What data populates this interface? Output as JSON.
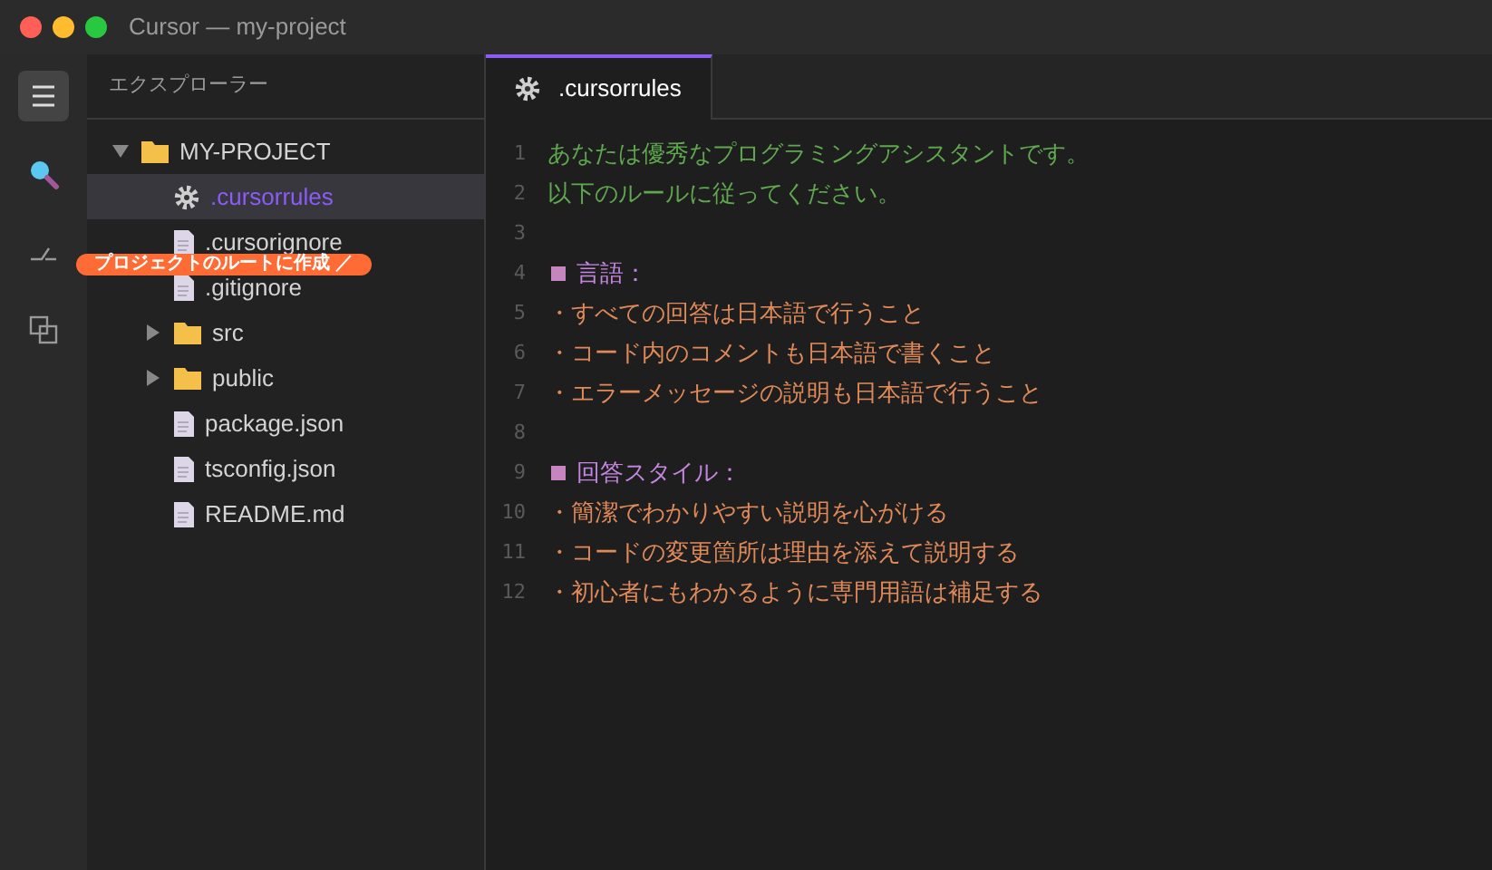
{
  "window": {
    "title": "Cursor — my-project"
  },
  "activity_bar": [
    {
      "kind": "menu",
      "selected": true
    },
    {
      "kind": "search",
      "selected": false
    },
    {
      "kind": "git",
      "selected": false
    },
    {
      "kind": "extensions",
      "selected": false
    }
  ],
  "sidebar": {
    "title": "エクスプローラー",
    "tree": [
      {
        "name": "MY-PROJECT",
        "kind": "folder",
        "expanded": true,
        "children": [
          {
            "name": ".cursorrules",
            "kind": "settings",
            "selected": true
          },
          {
            "name": ".cursorignore",
            "kind": "file",
            "selected": false
          },
          {
            "name": ".gitignore",
            "kind": "file",
            "selected": false
          },
          {
            "name": "src",
            "kind": "folder",
            "expanded": false,
            "selected": false
          },
          {
            "name": "public",
            "kind": "folder",
            "expanded": false,
            "selected": false
          },
          {
            "name": "package.json",
            "kind": "file",
            "selected": false
          },
          {
            "name": "tsconfig.json",
            "kind": "file",
            "selected": false
          },
          {
            "name": "README.md",
            "kind": "file",
            "selected": false
          }
        ]
      }
    ]
  },
  "callout": {
    "text": "プロジェクトのルートに作成 ／"
  },
  "tabs": [
    {
      "label": ".cursorrules",
      "selected": true
    }
  ],
  "editor": {
    "lines": [
      {
        "number": "1",
        "kind": "comment",
        "text": "あなたは優秀なプログラミングアシスタントです。"
      },
      {
        "number": "2",
        "kind": "comment",
        "text": "以下のルールに従ってください。"
      },
      {
        "number": "3",
        "kind": "blank"
      },
      {
        "number": "4",
        "kind": "heading",
        "text": "言語："
      },
      {
        "number": "5",
        "kind": "bullet",
        "text": "・すべての回答は日本語で行うこと"
      },
      {
        "number": "6",
        "kind": "bullet",
        "text": "・コード内のコメントも日本語で書くこと"
      },
      {
        "number": "7",
        "kind": "bullet",
        "text": "・エラーメッセージの説明も日本語で行うこと"
      },
      {
        "number": "8",
        "kind": "blank"
      },
      {
        "number": "9",
        "kind": "heading",
        "text": "回答スタイル："
      },
      {
        "number": "10",
        "kind": "bullet",
        "text": "・簡潔でわかりやすい説明を心がける"
      },
      {
        "number": "11",
        "kind": "bullet",
        "text": "・コードの変更箇所は理由を添えて説明する"
      },
      {
        "number": "12",
        "kind": "bullet",
        "text": "・初心者にもわかるように専門用語は補足する"
      }
    ]
  }
}
